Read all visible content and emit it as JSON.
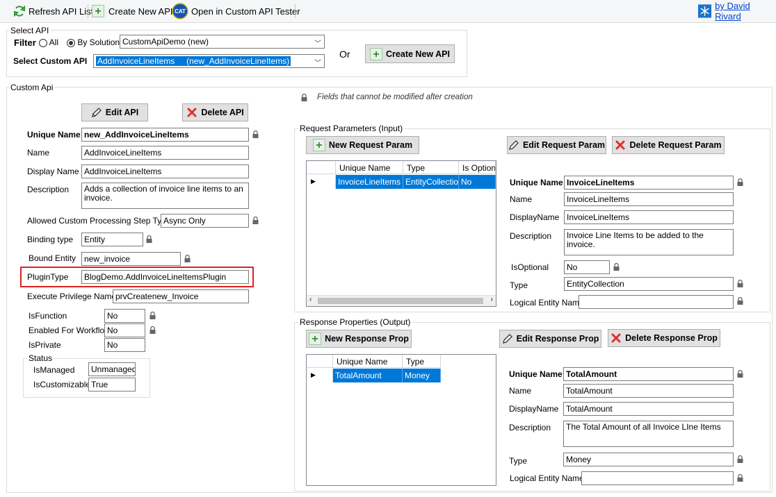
{
  "toolbar": {
    "refresh": "Refresh API List",
    "create": "Create New API",
    "open_tester": "Open in Custom API Tester",
    "cat_logo": "CAT",
    "author": "by David Rivard"
  },
  "select_api": {
    "title": "Select API",
    "filter_label": "Filter",
    "all_label": "All",
    "by_solution_label": "By Solution",
    "solution_value": "CustomApiDemo (new)",
    "select_label": "Select Custom API",
    "api_value": "AddInvoiceLineItems     (new_AddInvoiceLineItems)",
    "or_label": "Or",
    "create_button": "Create New API"
  },
  "custom_api": {
    "title": "Custom Api",
    "edit_button": "Edit API",
    "delete_button": "Delete API",
    "lock_note": "Fields that cannot be modified after creation",
    "unique_name_label": "Unique Name",
    "unique_name": "new_AddInvoiceLineItems",
    "name_label": "Name",
    "name": "AddInvoiceLineItems",
    "display_name_label": "Display Name",
    "display_name": "AddInvoiceLineItems",
    "description_label": "Description",
    "description": "Adds a collection of invoice line items to an invoice.",
    "step_type_label": "Allowed Custom Processing Step Type",
    "step_type": "Async Only",
    "binding_type_label": "Binding type",
    "binding_type": "Entity",
    "bound_entity_label": "Bound Entity",
    "bound_entity": "new_invoice",
    "plugin_type_label": "PluginType",
    "plugin_type": "BlogDemo.AddInvoiceLineItemsPlugin",
    "privilege_label": "Execute Privilege Name",
    "privilege": "prvCreatenew_Invoice",
    "is_function_label": "IsFunction",
    "is_function": "No",
    "workflow_label": "Enabled For Workflow",
    "workflow": "No",
    "is_private_label": "IsPrivate",
    "is_private": "No",
    "status_title": "Status",
    "is_managed_label": "IsManaged",
    "is_managed": "Unmanaged",
    "is_customizable_label": "IsCustomizable",
    "is_customizable": "True"
  },
  "request": {
    "title": "Request Parameters (Input)",
    "new_button": "New Request Param",
    "edit_button": "Edit Request Param",
    "delete_button": "Delete Request Param",
    "columns": [
      "Unique Name",
      "Type",
      "Is Optiona"
    ],
    "rows": [
      [
        "InvoiceLineItems",
        "EntityCollection",
        "No"
      ]
    ],
    "unique_name_label": "Unique Name",
    "unique_name": "InvoiceLineItems",
    "name_label": "Name",
    "name": "InvoiceLineItems",
    "display_name_label": "DisplayName",
    "display_name": "InvoiceLineItems",
    "description_label": "Description",
    "description": "Invoice Line Items to be added to the invoice.",
    "optional_label": "IsOptional",
    "optional": "No",
    "type_label": "Type",
    "type": "EntityCollection",
    "logical_entity_label": "Logical Entity Name",
    "logical_entity": ""
  },
  "response": {
    "title": "Response Properties (Output)",
    "new_button": "New Response Prop",
    "edit_button": "Edit Response Prop",
    "delete_button": "Delete Response Prop",
    "columns": [
      "Unique Name",
      "Type"
    ],
    "rows": [
      [
        "TotalAmount",
        "Money"
      ]
    ],
    "unique_name_label": "Unique Name",
    "unique_name": "TotalAmount",
    "name_label": "Name",
    "name": "TotalAmount",
    "display_name_label": "DisplayName",
    "display_name": "TotalAmount",
    "description_label": "Description",
    "description": "The Total Amount of all Invoice LIne Items",
    "type_label": "Type",
    "type": "Money",
    "logical_entity_label": "Logical Entity Name",
    "logical_entity": ""
  },
  "colors": {
    "selection": "#0078d7",
    "highlight_border": "#e02020",
    "grid_select": "#0078d7"
  }
}
